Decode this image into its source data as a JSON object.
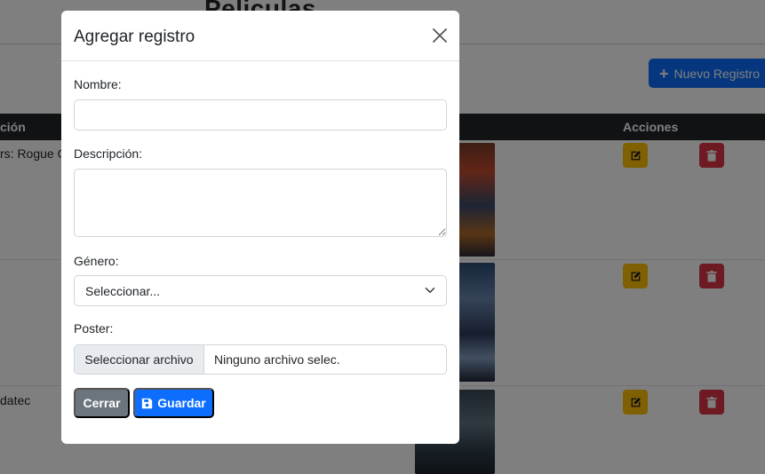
{
  "page": {
    "title": "Peliculas",
    "new_button_label": "Nuevo Registro",
    "table": {
      "headers": {
        "descripcion": "ción",
        "acciones": "Acciones"
      },
      "rows": [
        {
          "descripcion": "rs: Rogue O"
        },
        {
          "descripcion": ""
        },
        {
          "descripcion": "datec"
        }
      ]
    }
  },
  "modal": {
    "title": "Agregar registro",
    "fields": {
      "nombre": {
        "label": "Nombre:",
        "value": ""
      },
      "descripcion": {
        "label": "Descripción:",
        "value": ""
      },
      "genero": {
        "label": "Género:",
        "selected": "Seleccionar..."
      },
      "poster": {
        "label": "Poster:",
        "button": "Seleccionar archivo",
        "file_name": "Ninguno archivo selec."
      }
    },
    "buttons": {
      "close": "Cerrar",
      "save": "Guardar"
    }
  },
  "colors": {
    "primary": "#0d6efd",
    "secondary": "#6c757d",
    "warning": "#ffc107",
    "danger": "#dc3545",
    "table_header": "#212529"
  },
  "icons": [
    "plus-icon",
    "close-icon",
    "chevron-down-icon",
    "save-icon",
    "edit-icon",
    "trash-icon"
  ]
}
